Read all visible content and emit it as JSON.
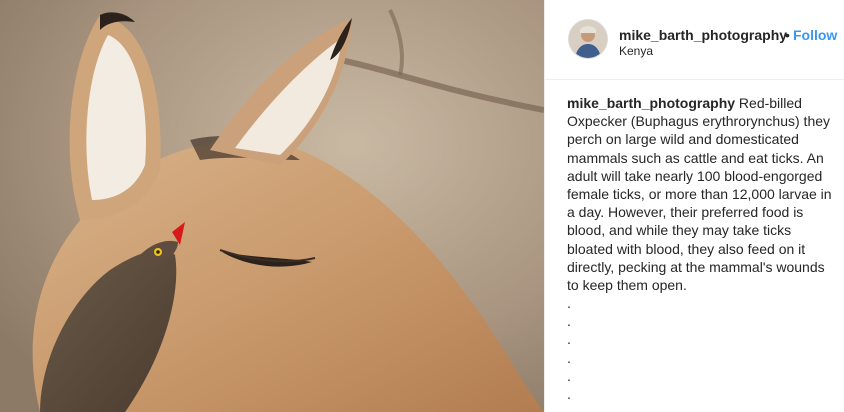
{
  "post": {
    "username": "mike_barth_photography",
    "separator": "•",
    "follow_label": "Follow",
    "location": "Kenya",
    "caption_text": "Red-billed Oxpecker (Buphagus erythrorynchus) they perch on large wild and domesticated mammals such as cattle and eat ticks. An adult will take nearly 100 blood-engorged female ticks, or more than 12,000 larvae in a day. However, their preferred food is blood, and while they may take ticks bloated with blood, they also feed on it directly, pecking at the mammal's wounds to keep them open.",
    "trailing_dots": [
      ".",
      ".",
      ".",
      ".",
      ".",
      "."
    ]
  },
  "colors": {
    "follow": "#3897f0",
    "text": "#262626",
    "divider": "#efefef"
  },
  "icons": {
    "avatar": "profile-photo"
  }
}
